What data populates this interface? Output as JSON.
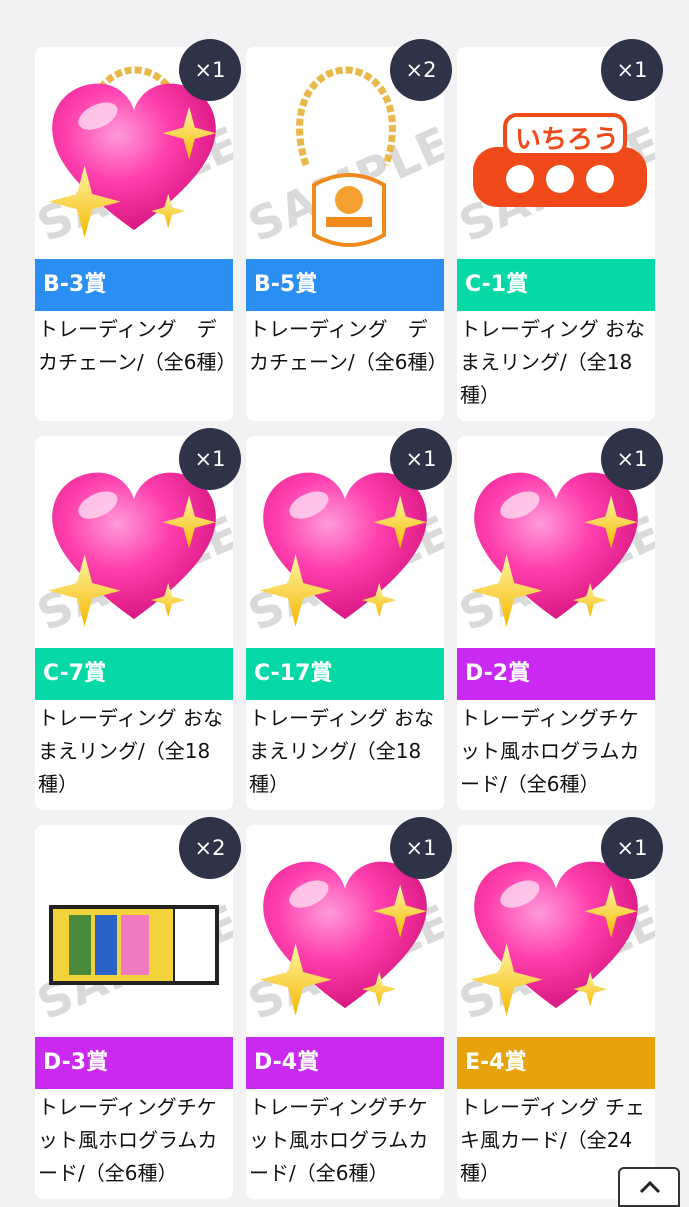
{
  "colors": {
    "blue": "#2b8ef2",
    "teal": "#07d9a6",
    "purple": "#c929f0",
    "orange": "#e8a30c",
    "badge": "#2e3347"
  },
  "watermark": "SAMPLE",
  "items": [
    {
      "code": "B-3賞",
      "qty": "×1",
      "desc": "トレーディング　デカチェーン/（全6種）",
      "color": "blue",
      "image": "heart-sticker-over-chain"
    },
    {
      "code": "B-5賞",
      "qty": "×2",
      "desc": "トレーディング　デカチェーン/（全6種）",
      "color": "blue",
      "image": "chain-charm"
    },
    {
      "code": "C-1賞",
      "qty": "×1",
      "desc": "トレーディング おなまえリング/（全18種）",
      "color": "teal",
      "image": "name-ring"
    },
    {
      "code": "C-7賞",
      "qty": "×1",
      "desc": "トレーディング おなまえリング/（全18種）",
      "color": "teal",
      "image": "heart-sticker"
    },
    {
      "code": "C-17賞",
      "qty": "×1",
      "desc": "トレーディング おなまえリング/（全18種）",
      "color": "teal",
      "image": "heart-sticker"
    },
    {
      "code": "D-2賞",
      "qty": "×1",
      "desc": "トレーディングチケット風ホログラムカード/（全6種）",
      "color": "purple",
      "image": "heart-sticker"
    },
    {
      "code": "D-3賞",
      "qty": "×2",
      "desc": "トレーディングチケット風ホログラムカード/（全6種）",
      "color": "purple",
      "image": "ticket-card"
    },
    {
      "code": "D-4賞",
      "qty": "×1",
      "desc": "トレーディングチケット風ホログラムカード/（全6種）",
      "color": "purple",
      "image": "heart-sticker"
    },
    {
      "code": "E-4賞",
      "qty": "×1",
      "desc": "トレーディング チェキ風カード/（全24種）",
      "color": "orange",
      "image": "heart-sticker"
    }
  ],
  "ring_text": "いちろう"
}
